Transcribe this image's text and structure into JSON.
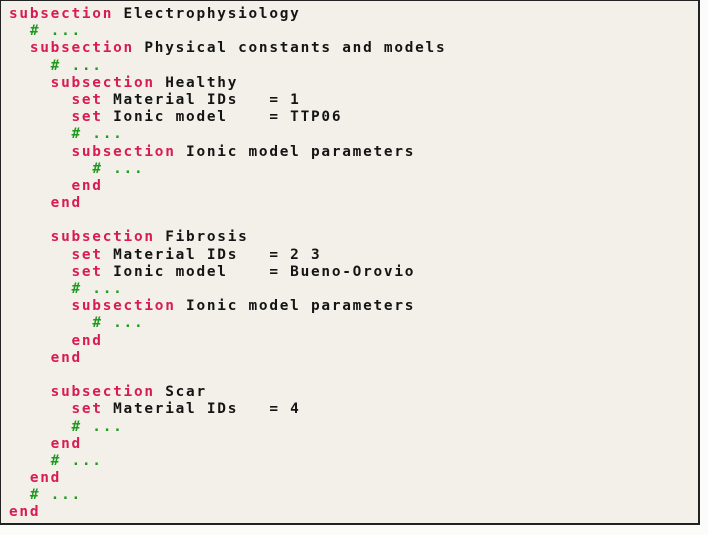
{
  "document": {
    "colors": {
      "keyword": "#d81b51",
      "comment": "#1f9a1f",
      "text": "#141414",
      "background": "#f2f0e9"
    },
    "lines": [
      {
        "indent": 0,
        "kw": "subsection",
        "text": " Electrophysiology"
      },
      {
        "indent": 1,
        "comment": "# ..."
      },
      {
        "indent": 1,
        "kw": "subsection",
        "text": " Physical constants and models"
      },
      {
        "indent": 2,
        "comment": "# ..."
      },
      {
        "indent": 2,
        "kw": "subsection",
        "text": " Healthy"
      },
      {
        "indent": 3,
        "kw": "set",
        "text": " Material IDs   = 1"
      },
      {
        "indent": 3,
        "kw": "set",
        "text": " Ionic model    = TTP06"
      },
      {
        "indent": 3,
        "comment": "# ..."
      },
      {
        "indent": 3,
        "kw": "subsection",
        "text": " Ionic model parameters"
      },
      {
        "indent": 4,
        "comment": "# ..."
      },
      {
        "indent": 3,
        "kw": "end",
        "text": ""
      },
      {
        "indent": 2,
        "kw": "end",
        "text": ""
      },
      {
        "indent": 0,
        "text": ""
      },
      {
        "indent": 2,
        "kw": "subsection",
        "text": " Fibrosis"
      },
      {
        "indent": 3,
        "kw": "set",
        "text": " Material IDs   = 2 3"
      },
      {
        "indent": 3,
        "kw": "set",
        "text": " Ionic model    = Bueno-Orovio"
      },
      {
        "indent": 3,
        "comment": "# ..."
      },
      {
        "indent": 3,
        "kw": "subsection",
        "text": " Ionic model parameters"
      },
      {
        "indent": 4,
        "comment": "# ..."
      },
      {
        "indent": 3,
        "kw": "end",
        "text": ""
      },
      {
        "indent": 2,
        "kw": "end",
        "text": ""
      },
      {
        "indent": 0,
        "text": ""
      },
      {
        "indent": 2,
        "kw": "subsection",
        "text": " Scar"
      },
      {
        "indent": 3,
        "kw": "set",
        "text": " Material IDs   = 4"
      },
      {
        "indent": 3,
        "comment": "# ..."
      },
      {
        "indent": 2,
        "kw": "end",
        "text": ""
      },
      {
        "indent": 2,
        "comment": "# ..."
      },
      {
        "indent": 1,
        "kw": "end",
        "text": ""
      },
      {
        "indent": 1,
        "comment": "# ..."
      },
      {
        "indent": 0,
        "kw": "end",
        "text": ""
      }
    ]
  }
}
